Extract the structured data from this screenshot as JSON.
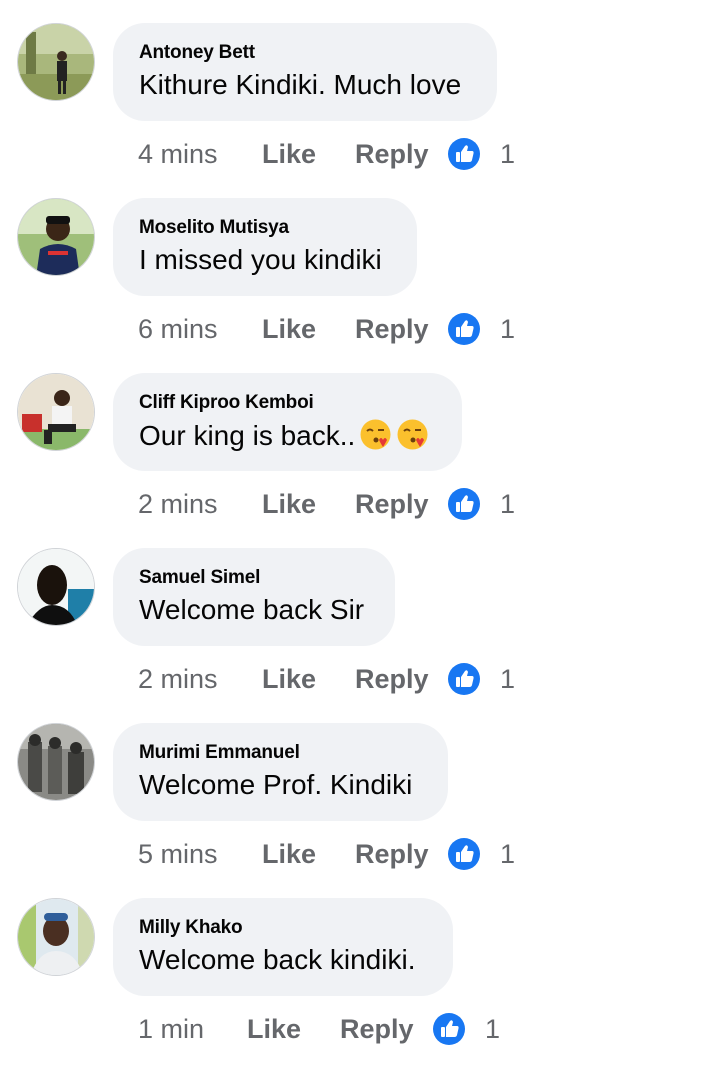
{
  "comments": [
    {
      "author": "Antoney Bett",
      "text": "Kithure Kindiki. Much love",
      "time": "4 mins",
      "like_label": "Like",
      "reply_label": "Reply",
      "reaction_icon": "thumbs-up-icon",
      "reaction_count": "1"
    },
    {
      "author": "Moselito Mutisya",
      "text": "I missed you kindiki",
      "time": "6 mins",
      "like_label": "Like",
      "reply_label": "Reply",
      "reaction_icon": "thumbs-up-icon",
      "reaction_count": "1"
    },
    {
      "author": "Cliff Kiproo Kemboi",
      "text": "Our king is back..",
      "emojis": [
        "kissing-face-icon",
        "kissing-face-icon"
      ],
      "time": "2 mins",
      "like_label": "Like",
      "reply_label": "Reply",
      "reaction_icon": "thumbs-up-icon",
      "reaction_count": "1"
    },
    {
      "author": "Samuel Simel",
      "text": "Welcome back Sir",
      "time": "2 mins",
      "like_label": "Like",
      "reply_label": "Reply",
      "reaction_icon": "thumbs-up-icon",
      "reaction_count": "1"
    },
    {
      "author": "Murimi Emmanuel",
      "text": "Welcome Prof. Kindiki",
      "time": "5 mins",
      "like_label": "Like",
      "reply_label": "Reply",
      "reaction_icon": "thumbs-up-icon",
      "reaction_count": "1"
    },
    {
      "author": "Milly Khako",
      "text": "Welcome back kindiki.",
      "time": "1 min",
      "like_label": "Like",
      "reply_label": "Reply",
      "reaction_icon": "thumbs-up-icon",
      "reaction_count": "1"
    }
  ],
  "colors": {
    "bubble_bg": "#f0f2f5",
    "text": "#050505",
    "meta": "#65676b",
    "like_blue": "#1877f2"
  }
}
